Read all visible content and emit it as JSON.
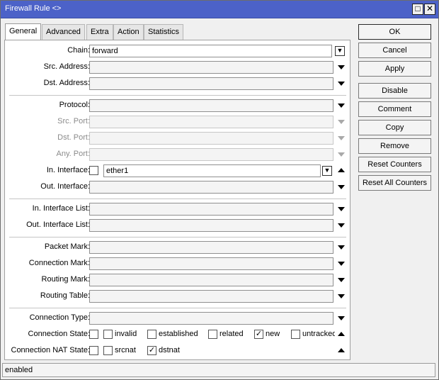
{
  "window": {
    "title": "Firewall Rule <>",
    "restore_glyph": "□",
    "close_glyph": "✕"
  },
  "tabs": [
    {
      "label": "General",
      "active": true
    },
    {
      "label": "Advanced"
    },
    {
      "label": "Extra"
    },
    {
      "label": "Action"
    },
    {
      "label": "Statistics"
    }
  ],
  "form": {
    "chain": {
      "label": "Chain:",
      "value": "forward"
    },
    "src_address": {
      "label": "Src. Address:",
      "value": ""
    },
    "dst_address": {
      "label": "Dst. Address:",
      "value": ""
    },
    "protocol": {
      "label": "Protocol:",
      "value": ""
    },
    "src_port": {
      "label": "Src. Port:",
      "value": ""
    },
    "dst_port": {
      "label": "Dst. Port:",
      "value": ""
    },
    "any_port": {
      "label": "Any. Port:",
      "value": ""
    },
    "in_interface": {
      "label": "In. Interface:",
      "value": "ether1",
      "negate": false
    },
    "out_interface": {
      "label": "Out. Interface:",
      "value": ""
    },
    "in_interface_list": {
      "label": "In. Interface List:",
      "value": ""
    },
    "out_interface_list": {
      "label": "Out. Interface List:",
      "value": ""
    },
    "packet_mark": {
      "label": "Packet Mark:",
      "value": ""
    },
    "connection_mark": {
      "label": "Connection Mark:",
      "value": ""
    },
    "routing_mark": {
      "label": "Routing Mark:",
      "value": ""
    },
    "routing_table": {
      "label": "Routing Table:",
      "value": ""
    },
    "connection_type": {
      "label": "Connection Type:",
      "value": ""
    },
    "connection_state": {
      "label": "Connection State:",
      "negate": false,
      "options": [
        {
          "label": "invalid",
          "checked": false
        },
        {
          "label": "established",
          "checked": false
        },
        {
          "label": "related",
          "checked": false
        },
        {
          "label": "new",
          "checked": true
        },
        {
          "label": "untracked",
          "checked": false
        }
      ]
    },
    "connection_nat_state": {
      "label": "Connection NAT State:",
      "negate": false,
      "options": [
        {
          "label": "srcnat",
          "checked": false
        },
        {
          "label": "dstnat",
          "checked": true
        }
      ]
    }
  },
  "buttons": {
    "ok": "OK",
    "cancel": "Cancel",
    "apply": "Apply",
    "disable": "Disable",
    "comment": "Comment",
    "copy": "Copy",
    "remove": "Remove",
    "reset_counters": "Reset Counters",
    "reset_all_counters": "Reset All Counters"
  },
  "glyphs": {
    "check": "✓",
    "dropdown_box": "▼"
  },
  "status": {
    "text": "enabled"
  },
  "colors": {
    "titlebar": "#4c62c8"
  }
}
